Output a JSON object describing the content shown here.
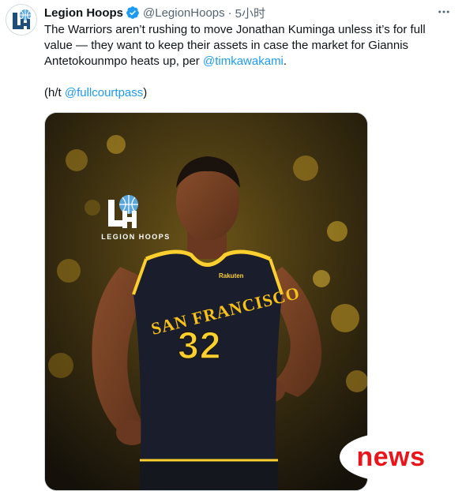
{
  "tweet": {
    "display_name": "Legion Hoops",
    "handle": "@LegionHoops",
    "separator": "·",
    "time": "5小时",
    "line1_before_mention": "The Warriors aren’t rushing to move Jonathan Kuminga unless it’s for full value — they want to keep their assets in case the market for Giannis Antetokounmpo heats up, per ",
    "mention_primary": "@timkawakami",
    "line1_after_mention": ".",
    "ht_prefix": "(h/t ",
    "mention_secondary": "@fullcourtpass",
    "ht_suffix": ")"
  },
  "media": {
    "logo_label": "LEGION HOOPS",
    "jersey_text": "SAN FRANCISCO",
    "jersey_number": "32",
    "sponsor": "Rakuten"
  },
  "overlay": {
    "badge_text": "news"
  },
  "icons": {
    "verified": "verified-badge-icon",
    "more": "more-options-icon"
  },
  "colors": {
    "accent": "#1d9bf0",
    "secondary_text": "#536471",
    "badge_red": "#e8151b",
    "jersey_gold": "#fbd02e",
    "jersey_navy": "#1a1d2b"
  }
}
